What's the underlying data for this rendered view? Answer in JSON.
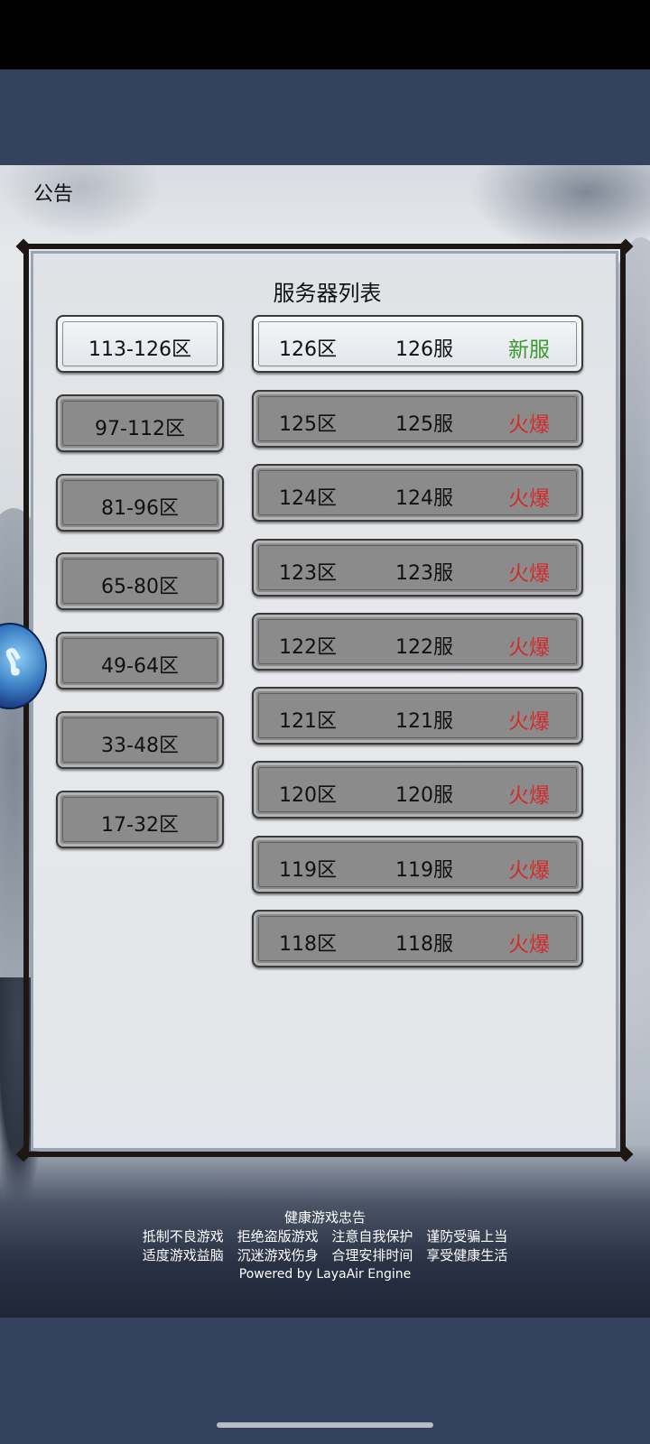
{
  "notice": {
    "label": "公告"
  },
  "panel": {
    "title": "服务器列表"
  },
  "zones": [
    {
      "label": "113-126区",
      "selected": true
    },
    {
      "label": "97-112区",
      "selected": false
    },
    {
      "label": "81-96区",
      "selected": false
    },
    {
      "label": "65-80区",
      "selected": false
    },
    {
      "label": "49-64区",
      "selected": false
    },
    {
      "label": "33-48区",
      "selected": false
    },
    {
      "label": "17-32区",
      "selected": false
    }
  ],
  "servers": [
    {
      "zone": "126区",
      "name": "126服",
      "status": "新服",
      "status_color": "#3c9a2c",
      "selected": true
    },
    {
      "zone": "125区",
      "name": "125服",
      "status": "火爆",
      "status_color": "#d42a2a",
      "selected": false
    },
    {
      "zone": "124区",
      "name": "124服",
      "status": "火爆",
      "status_color": "#d42a2a",
      "selected": false
    },
    {
      "zone": "123区",
      "name": "123服",
      "status": "火爆",
      "status_color": "#d42a2a",
      "selected": false
    },
    {
      "zone": "122区",
      "name": "122服",
      "status": "火爆",
      "status_color": "#d42a2a",
      "selected": false
    },
    {
      "zone": "121区",
      "name": "121服",
      "status": "火爆",
      "status_color": "#d42a2a",
      "selected": false
    },
    {
      "zone": "120区",
      "name": "120服",
      "status": "火爆",
      "status_color": "#d42a2a",
      "selected": false
    },
    {
      "zone": "119区",
      "name": "119服",
      "status": "火爆",
      "status_color": "#d42a2a",
      "selected": false
    },
    {
      "zone": "118区",
      "name": "118服",
      "status": "火爆",
      "status_color": "#d42a2a",
      "selected": false
    }
  ],
  "side_orb": {
    "icon": "cloud-swirl-icon"
  },
  "health": {
    "title": "健康游戏忠告",
    "line1": [
      "抵制不良游戏",
      "拒绝盗版游戏",
      "注意自我保护",
      "谨防受骗上当"
    ],
    "line2": [
      "适度游戏益脑",
      "沉迷游戏伤身",
      "合理安排时间",
      "享受健康生活"
    ],
    "powered": "Powered by LayaAir Engine"
  }
}
